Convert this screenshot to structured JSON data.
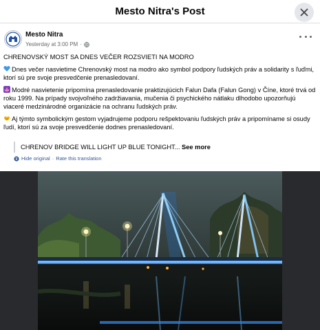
{
  "header": {
    "title": "Mesto Nitra's Post"
  },
  "post": {
    "author": "Mesto Nitra",
    "time": "Yesterday at 3:00 PM",
    "separator": "·",
    "headline": "CHRENOVSKÝ MOST SA DNES VEČER ROZSVIETI NA MODRO",
    "paragraph1": "Dnes večer nasvietime Chrenovský most na modro ako symbol podpory ľudských práv a solidarity s ľuďmi, ktorí sú pre svoje presvedčenie prenasledovaní.",
    "paragraph2": "Modré nasvietenie pripomína prenasledovanie praktizujúcich Falun Dafa (Falun Gong) v Číne, ktoré trvá od roku 1999. Na prípady svojvoľného zadržiavania, mučenia či psychického nátlaku dlhodobo upozorňujú viaceré medzinárodné organizácie na ochranu ľudských práv.",
    "paragraph3": "Aj týmto symbolickým gestom vyjadrujeme podporu rešpektovaniu ľudských práv a pripomíname si osudy ľudí, ktorí sú za svoje presvedčenie dodnes prenasledovaní.",
    "translation_preview": "CHRENOV BRIDGE WILL LIGHT UP BLUE TONIGHT...",
    "see_more": "See more",
    "hide_original": "Hide original",
    "dot": "·",
    "rate_translation": "Rate this translation"
  },
  "icons": {
    "close": "close-icon",
    "more": "more-options-icon",
    "globe": "globe-icon",
    "translate": "translate-icon"
  },
  "colors": {
    "link": "#385898",
    "muted": "#65676b",
    "bridge_light": "#3aa0ff"
  }
}
